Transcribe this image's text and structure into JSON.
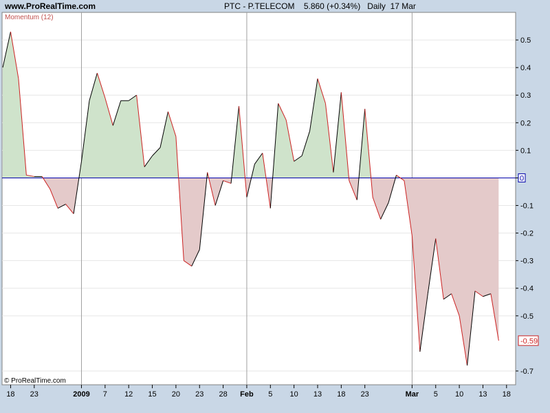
{
  "header": {
    "site": "www.ProRealTime.com",
    "ticker": "PTC - P.TELECOM",
    "price": "5.860 (+0.34%)",
    "period": "Daily",
    "date": "17 Mar"
  },
  "indicator_label": "Momentum (12)",
  "copyright": "© ProRealTime.com",
  "colors": {
    "background": "#c9d7e6",
    "plot_background": "#ffffff",
    "positive_fill": "#cfe3cb",
    "negative_fill": "#e4caca",
    "zero_line": "#0000aa",
    "line_up": "#000000",
    "line_down": "#cc2222",
    "value_tag": "#cc2222"
  },
  "chart_data": {
    "type": "area",
    "title": "PTC - P.TELECOM",
    "indicator": "Momentum (12)",
    "ylim": [
      -0.75,
      0.6
    ],
    "y_ticks": [
      0.5,
      0.4,
      0.3,
      0.2,
      0.1,
      0,
      -0.1,
      -0.2,
      -0.3,
      -0.4,
      -0.5,
      -0.7
    ],
    "y_tick_labels": [
      "0.5",
      "0.4",
      "0.3",
      "0.2",
      "0.1",
      "0",
      "-0.1",
      "-0.2",
      "-0.3",
      "-0.4",
      "-0.5",
      "-0.7"
    ],
    "zero_tag": "0",
    "last_value_tag": "-0.59",
    "last_value": -0.59,
    "x_labels": [
      {
        "label": "18",
        "index": 1,
        "major": false
      },
      {
        "label": "23",
        "index": 4,
        "major": false
      },
      {
        "label": "2009",
        "index": 10,
        "major": true
      },
      {
        "label": "7",
        "index": 13,
        "major": false
      },
      {
        "label": "12",
        "index": 16,
        "major": false
      },
      {
        "label": "15",
        "index": 19,
        "major": false
      },
      {
        "label": "20",
        "index": 22,
        "major": false
      },
      {
        "label": "23",
        "index": 25,
        "major": false
      },
      {
        "label": "28",
        "index": 28,
        "major": false
      },
      {
        "label": "Feb",
        "index": 31,
        "major": true
      },
      {
        "label": "5",
        "index": 34,
        "major": false
      },
      {
        "label": "10",
        "index": 37,
        "major": false
      },
      {
        "label": "13",
        "index": 40,
        "major": false
      },
      {
        "label": "18",
        "index": 43,
        "major": false
      },
      {
        "label": "23",
        "index": 46,
        "major": false
      },
      {
        "label": "Mar",
        "index": 52,
        "major": true
      },
      {
        "label": "5",
        "index": 55,
        "major": false
      },
      {
        "label": "10",
        "index": 58,
        "major": false
      },
      {
        "label": "13",
        "index": 61,
        "major": false
      },
      {
        "label": "18",
        "index": 64,
        "major": false
      }
    ],
    "vertical_gridlines_at_index": [
      10,
      31,
      52
    ],
    "values": [
      0.4,
      0.53,
      0.36,
      0.01,
      0.005,
      0.005,
      -0.04,
      -0.11,
      -0.095,
      -0.13,
      0.06,
      0.28,
      0.38,
      0.29,
      0.19,
      0.28,
      0.28,
      0.3,
      0.04,
      0.08,
      0.11,
      0.24,
      0.15,
      -0.3,
      -0.32,
      -0.26,
      0.02,
      -0.1,
      -0.01,
      -0.02,
      0.26,
      -0.07,
      0.05,
      0.09,
      -0.11,
      0.27,
      0.21,
      0.06,
      0.08,
      0.17,
      0.36,
      0.27,
      0.02,
      0.31,
      -0.01,
      -0.08,
      0.25,
      -0.07,
      -0.15,
      -0.09,
      0.01,
      -0.01,
      -0.21,
      -0.63,
      -0.42,
      -0.22,
      -0.44,
      -0.42,
      -0.5,
      -0.68,
      -0.41,
      -0.43,
      -0.42,
      -0.59
    ]
  }
}
